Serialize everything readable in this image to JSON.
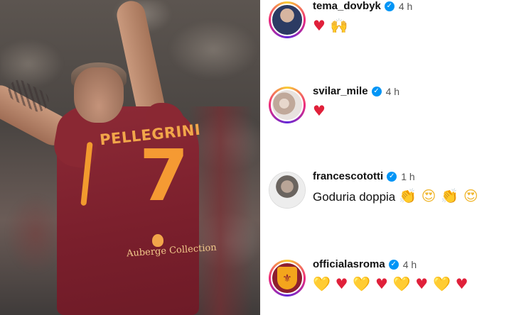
{
  "photo": {
    "jersey_name": "PELLEGRINI",
    "jersey_number": "7",
    "jersey_sponsor": "Auberge Collection"
  },
  "comments": [
    {
      "username": "tema_dovbyk",
      "time": "4 h",
      "text": "",
      "emojis": [
        "♥",
        "🙌"
      ],
      "avatar_icon": "player-avatar"
    },
    {
      "username": "svilar_mile",
      "time": "4 h",
      "text": "",
      "emojis": [
        "♥"
      ],
      "avatar_icon": "family-avatar"
    },
    {
      "username": "francescototti",
      "time": "1 h",
      "text": "Goduria doppia",
      "emojis": [
        "👏",
        "😍",
        "👏",
        "😍"
      ],
      "avatar_icon": "portrait-avatar"
    },
    {
      "username": "officialasroma",
      "time": "4 h",
      "text": "",
      "emojis": [
        "💛",
        "♥",
        "💛",
        "♥",
        "💛",
        "♥",
        "💛",
        "♥"
      ],
      "avatar_icon": "as-roma-crest"
    }
  ],
  "colors": {
    "verified": "#0095f6",
    "heart_red": "#e0203a",
    "heart_yellow": "#f5c518",
    "roma_maroon": "#8e1f2f",
    "roma_orange": "#f59a33"
  }
}
